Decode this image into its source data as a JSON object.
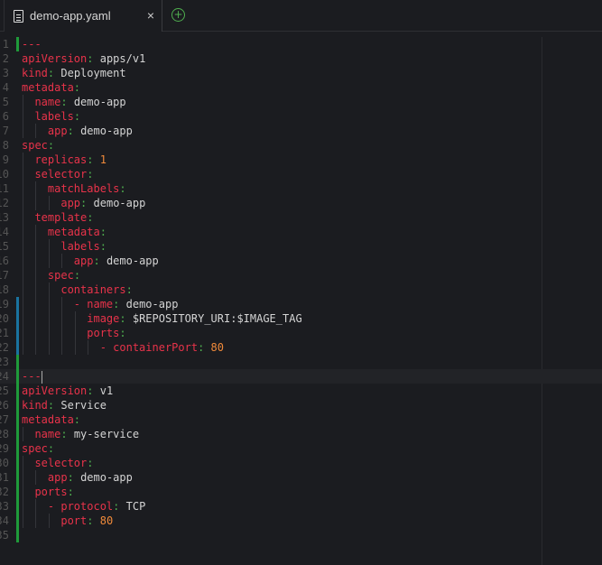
{
  "tab": {
    "filename": "demo-app.yaml",
    "close": "×",
    "add": "+"
  },
  "colors": {
    "added": "#1f9a3a",
    "modified": "#1a73a0"
  },
  "lines": [
    {
      "n": "1",
      "indent": 0,
      "key": "---",
      "mark": "added"
    },
    {
      "n": "2",
      "indent": 0,
      "key": "apiVersion",
      "value": "apps/v1"
    },
    {
      "n": "3",
      "indent": 0,
      "key": "kind",
      "value": "Deployment"
    },
    {
      "n": "4",
      "indent": 0,
      "key": "metadata",
      "value": ""
    },
    {
      "n": "5",
      "indent": 1,
      "key": "name",
      "value": "demo-app"
    },
    {
      "n": "6",
      "indent": 1,
      "key": "labels",
      "value": ""
    },
    {
      "n": "7",
      "indent": 2,
      "key": "app",
      "value": "demo-app"
    },
    {
      "n": "8",
      "indent": 0,
      "key": "spec",
      "value": ""
    },
    {
      "n": "9",
      "indent": 1,
      "key": "replicas",
      "value": "1",
      "num": true
    },
    {
      "n": "10",
      "indent": 1,
      "key": "selector",
      "value": ""
    },
    {
      "n": "11",
      "indent": 2,
      "key": "matchLabels",
      "value": ""
    },
    {
      "n": "12",
      "indent": 3,
      "key": "app",
      "value": "demo-app"
    },
    {
      "n": "13",
      "indent": 1,
      "key": "template",
      "value": ""
    },
    {
      "n": "14",
      "indent": 2,
      "key": "metadata",
      "value": ""
    },
    {
      "n": "15",
      "indent": 3,
      "key": "labels",
      "value": ""
    },
    {
      "n": "16",
      "indent": 4,
      "key": "app",
      "value": "demo-app"
    },
    {
      "n": "17",
      "indent": 2,
      "key": "spec",
      "value": ""
    },
    {
      "n": "18",
      "indent": 3,
      "key": "containers",
      "value": ""
    },
    {
      "n": "19",
      "indent": 4,
      "dash": true,
      "key": "name",
      "value": "demo-app",
      "mark": "modified"
    },
    {
      "n": "20",
      "indent": 5,
      "key": "image",
      "value": "$REPOSITORY_URI:$IMAGE_TAG",
      "mark": "modified"
    },
    {
      "n": "21",
      "indent": 5,
      "key": "ports",
      "value": "",
      "mark": "modified"
    },
    {
      "n": "22",
      "indent": 6,
      "dash": true,
      "key": "containerPort",
      "value": "80",
      "num": true,
      "mark": "modified"
    },
    {
      "n": "23",
      "indent": 0,
      "blank": true,
      "mark": "added"
    },
    {
      "n": "24",
      "indent": 0,
      "key": "---",
      "mark": "added",
      "active": true
    },
    {
      "n": "25",
      "indent": 0,
      "key": "apiVersion",
      "value": "v1",
      "mark": "added"
    },
    {
      "n": "26",
      "indent": 0,
      "key": "kind",
      "value": "Service",
      "mark": "added"
    },
    {
      "n": "27",
      "indent": 0,
      "key": "metadata",
      "value": "",
      "mark": "added"
    },
    {
      "n": "28",
      "indent": 1,
      "key": "name",
      "value": "my-service",
      "mark": "added"
    },
    {
      "n": "29",
      "indent": 0,
      "key": "spec",
      "value": "",
      "mark": "added"
    },
    {
      "n": "30",
      "indent": 1,
      "key": "selector",
      "value": "",
      "mark": "added"
    },
    {
      "n": "31",
      "indent": 2,
      "key": "app",
      "value": "demo-app",
      "mark": "added"
    },
    {
      "n": "32",
      "indent": 1,
      "key": "ports",
      "value": "",
      "mark": "added"
    },
    {
      "n": "33",
      "indent": 2,
      "dash": true,
      "key": "protocol",
      "value": "TCP",
      "mark": "added"
    },
    {
      "n": "34",
      "indent": 3,
      "key": "port",
      "value": "80",
      "num": true,
      "mark": "added"
    },
    {
      "n": "35",
      "indent": 0,
      "blank": true,
      "mark": "added"
    }
  ]
}
